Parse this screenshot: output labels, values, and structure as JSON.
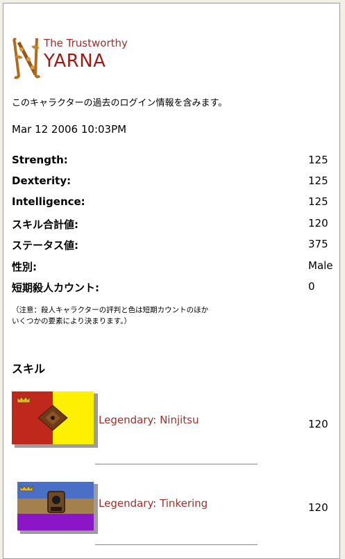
{
  "header": {
    "title_prefix": "The Trustworthy",
    "name": "YARNA",
    "initial_letter": "N"
  },
  "description": "このキャラクターの過去のログイン情報を含みます。",
  "last_login": "Mar 12 2006 10:03PM",
  "stats": [
    {
      "label": "Strength:",
      "value": "125"
    },
    {
      "label": "Dexterity:",
      "value": "125"
    },
    {
      "label": "Intelligence:",
      "value": "125"
    },
    {
      "label": "スキル合計値:",
      "value": "120"
    },
    {
      "label": "ステータス値:",
      "value": "375"
    },
    {
      "label": "性別:",
      "value": "Male"
    },
    {
      "label": "短期殺人カウント:",
      "value": "0"
    }
  ],
  "note_line1": "（注意：殺人キャラクターの評判と色は短期カウントのほか",
  "note_line2": "いくつかの要素により決まります。）",
  "skills_heading": "スキル",
  "skills": [
    {
      "name": "Legendary: Ninjitsu",
      "value": "120",
      "icon": "ninjitsu-banner-icon"
    },
    {
      "name": "Legendary: Tinkering",
      "value": "120",
      "icon": "tinkering-banner-icon"
    }
  ],
  "colors": {
    "title_red": "#a01c14",
    "skill_name": "#a0302a",
    "ninjitsu_red": "#c0281c",
    "ninjitsu_yellow": "#ffef00",
    "tinkering_blue": "#4a6fc8",
    "tinkering_brown": "#a4814c",
    "tinkering_purple": "#8a16c8"
  }
}
